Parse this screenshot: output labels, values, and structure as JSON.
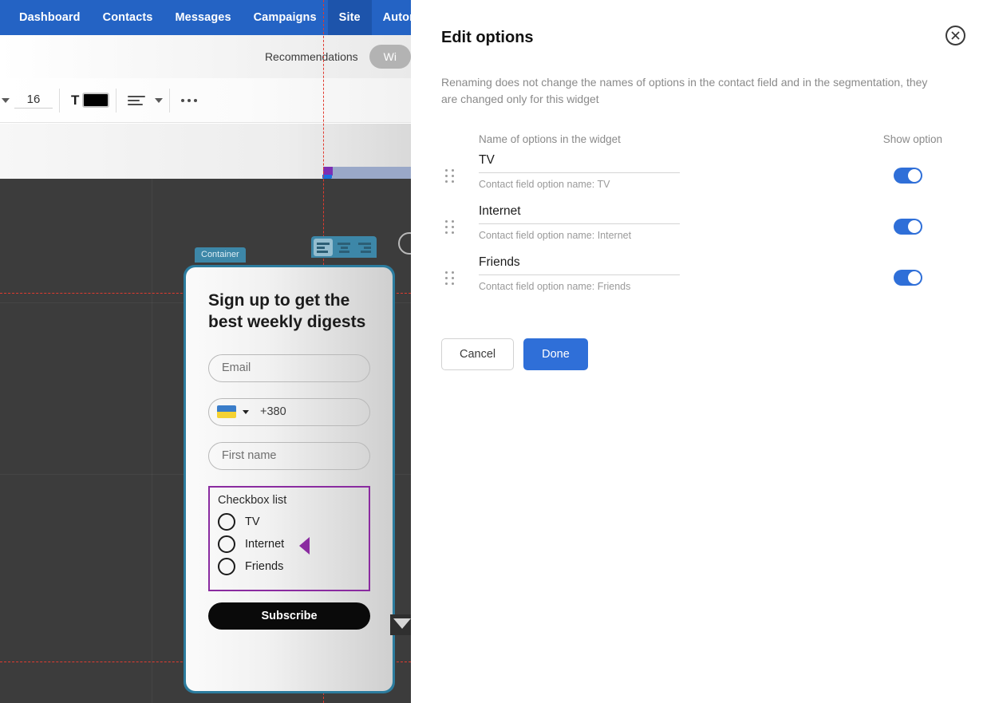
{
  "nav": {
    "items": [
      {
        "label": "Dashboard",
        "active": false
      },
      {
        "label": "Contacts",
        "active": false
      },
      {
        "label": "Messages",
        "active": false
      },
      {
        "label": "Campaigns",
        "active": false
      },
      {
        "label": "Site",
        "active": true
      },
      {
        "label": "Automation",
        "active": false
      }
    ]
  },
  "subnav": {
    "recommendations_label": "Recommendations",
    "widget_pill_label": "Wi"
  },
  "format_toolbar": {
    "font_size": "16",
    "text_color_glyph": "T",
    "text_color_hex": "#000000",
    "align_icon_name": "align-left-icon",
    "more_icon_name": "more-horizontal-icon"
  },
  "canvas": {
    "container_tab_label": "Container",
    "align_tools": [
      {
        "name": "align-left-tool",
        "active": true
      },
      {
        "name": "align-center-tool",
        "active": false
      },
      {
        "name": "align-right-tool",
        "active": false
      }
    ]
  },
  "widget": {
    "title": "Sign up to get the best weekly digests",
    "fields": [
      {
        "name": "email-field",
        "placeholder": "Email"
      },
      {
        "name": "first-name-field",
        "placeholder": "First name"
      }
    ],
    "phone": {
      "country_flag": "ua-flag-icon",
      "country_code": "+380"
    },
    "checkbox_list": {
      "title": "Checkbox list",
      "options": [
        "TV",
        "Internet",
        "Friends"
      ]
    },
    "submit_label": "Subscribe"
  },
  "panel": {
    "title": "Edit options",
    "description": "Renaming does not change the names of options in the contact field and in the segmentation, they are changed only for this widget",
    "column_headers": {
      "name": "Name of options in the widget",
      "show": "Show option"
    },
    "options": [
      {
        "name": "TV",
        "subtitle": "Contact field option name: TV",
        "show": true
      },
      {
        "name": "Internet",
        "subtitle": "Contact field option name: Internet",
        "show": true
      },
      {
        "name": "Friends",
        "subtitle": "Contact field option name: Friends",
        "show": true
      }
    ],
    "cancel_label": "Cancel",
    "done_label": "Done",
    "close_icon": "close-icon"
  },
  "colors": {
    "nav_blue": "#2463c4",
    "nav_active_blue": "#1d54ab",
    "primary_blue": "#2f6fd8",
    "selection_purple": "#8a2ba0",
    "container_teal": "#2c7c9e",
    "guide_red": "#e03b2f"
  }
}
